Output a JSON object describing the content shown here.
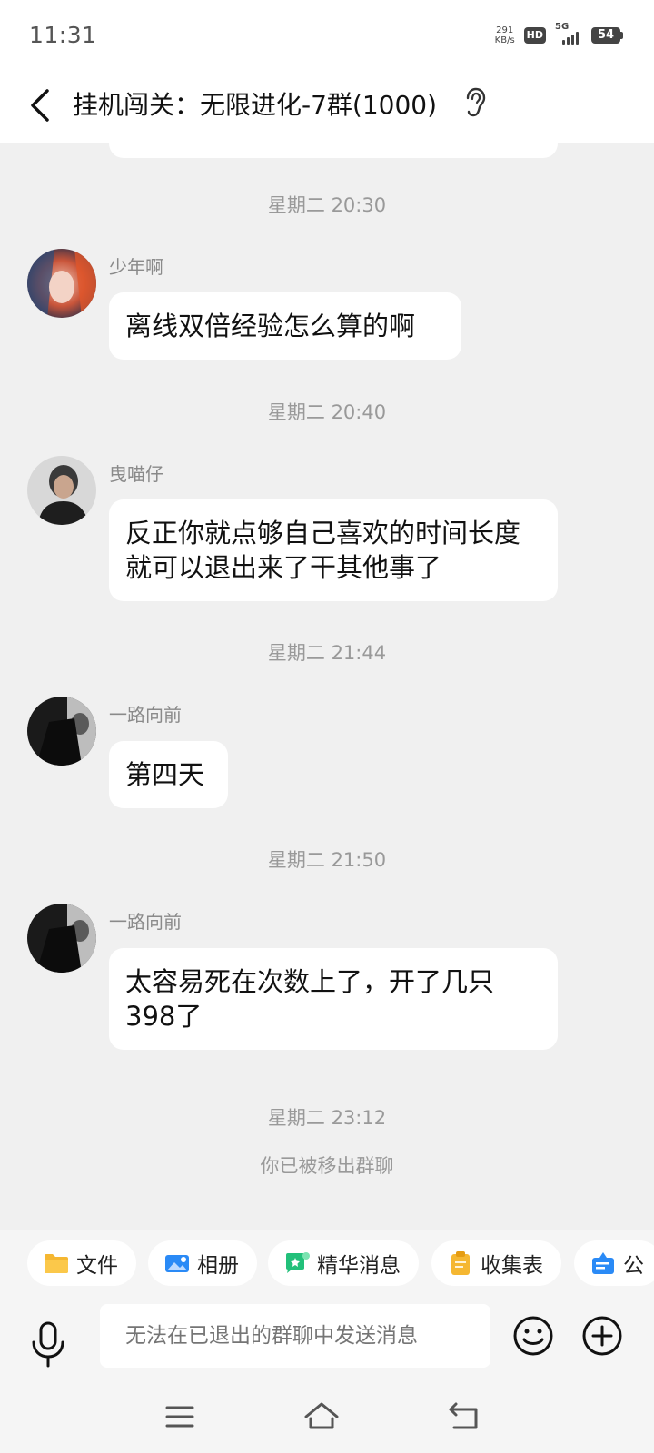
{
  "status_bar": {
    "time": "11:31",
    "net_speed_value": "291",
    "net_speed_unit": "KB/s",
    "hd_label": "HD",
    "network_label": "5G",
    "battery": "54"
  },
  "header": {
    "title": "挂机闯关：无限进化-7群(1000)"
  },
  "messages": [
    {
      "timestamp": "星期二 20:30",
      "sender": "少年啊",
      "text": "离线双倍经验怎么算的啊"
    },
    {
      "timestamp": "星期二 20:40",
      "sender": "曳喵仔",
      "text": "反正你就点够自己喜欢的时间长度就可以退出来了干其他事了"
    },
    {
      "timestamp": "星期二 21:44",
      "sender": "一路向前",
      "text": "第四天"
    },
    {
      "timestamp": "星期二 21:50",
      "sender": "一路向前",
      "text": "太容易死在次数上了，开了几只398了"
    }
  ],
  "system": {
    "timestamp": "星期二 23:12",
    "notice": "你已被移出群聊"
  },
  "quick_actions": [
    {
      "label": "文件",
      "icon": "folder-icon"
    },
    {
      "label": "相册",
      "icon": "photo-album-icon"
    },
    {
      "label": "精华消息",
      "icon": "essence-message-icon"
    },
    {
      "label": "收集表",
      "icon": "clipboard-icon"
    },
    {
      "label": "公",
      "icon": "announcement-icon"
    }
  ],
  "input": {
    "placeholder": "无法在已退出的群聊中发送消息"
  },
  "colors": {
    "background": "#f0f0f0",
    "bubble": "#ffffff",
    "meta_text": "#999999",
    "folder": "#f5b731",
    "album": "#2a8af6",
    "essence": "#22c07a"
  }
}
